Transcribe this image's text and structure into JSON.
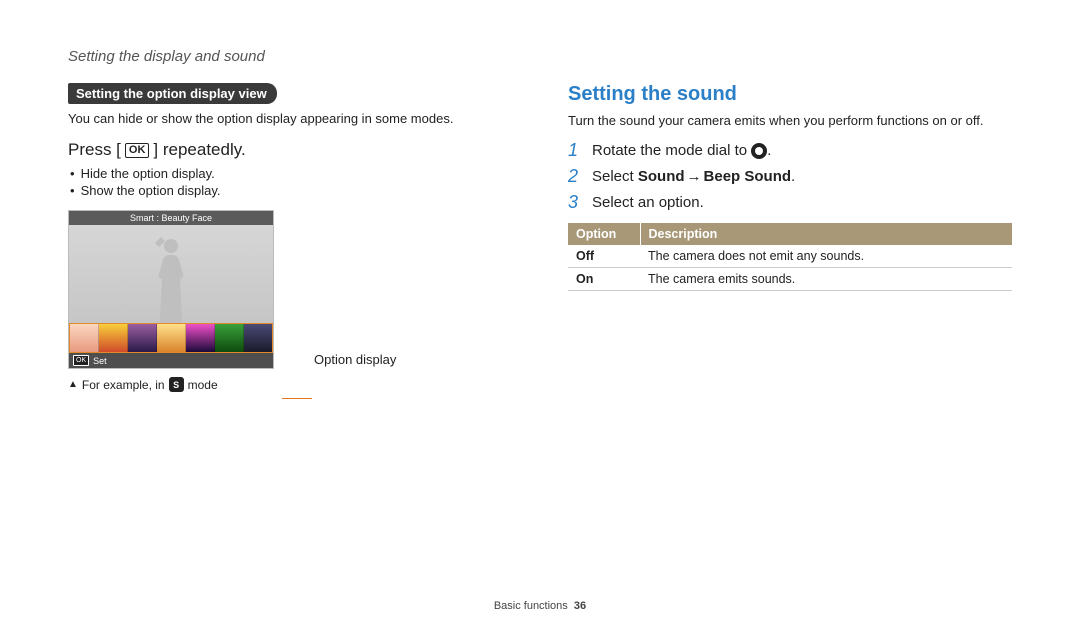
{
  "page_title": "Setting the display and sound",
  "left": {
    "section_label": "Setting the option display view",
    "intro": "You can hide or show the option display appearing in some modes.",
    "press_prefix": "Press [",
    "press_ok": "OK",
    "press_suffix": "] repeatedly.",
    "bullets": [
      "Hide the option display.",
      "Show the option display."
    ],
    "screenshot": {
      "header": "Smart : Beauty Face",
      "footer_ok": "OK",
      "footer_label": "Set"
    },
    "callout": "Option display",
    "footnote_prefix": "For example, in",
    "footnote_mode_letter": "S",
    "footnote_suffix": "mode"
  },
  "right": {
    "heading": "Setting the sound",
    "intro": "Turn the sound your camera emits when you perform functions on or off.",
    "steps": [
      {
        "num": "1",
        "text_pre": "Rotate the mode dial to ",
        "has_gear": true,
        "text_post": "."
      },
      {
        "num": "2",
        "text_pre": "Select ",
        "bold1": "Sound",
        "arrow": "→",
        "bold2": "Beep Sound",
        "text_post": "."
      },
      {
        "num": "3",
        "text_pre": "Select an option."
      }
    ],
    "table": {
      "headers": [
        "Option",
        "Description"
      ],
      "rows": [
        {
          "opt": "Off",
          "desc": "The camera does not emit any sounds."
        },
        {
          "opt": "On",
          "desc": "The camera emits sounds."
        }
      ]
    }
  },
  "footer": {
    "section": "Basic functions",
    "page": "36"
  }
}
